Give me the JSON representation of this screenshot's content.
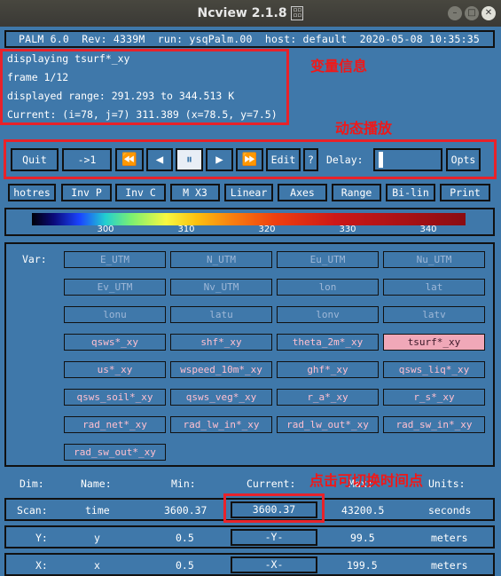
{
  "window": {
    "title": "Ncview 2.1.8",
    "title_icon": "icon-box"
  },
  "info_bar": "PALM 6.0  Rev: 4339M  run: ysqPalm.00  host: default  2020-05-08 10:35:35",
  "variable_info": {
    "displaying": "displaying tsurf*_xy",
    "frame": "frame 1/12",
    "range": "displayed range: 291.293 to 344.513 K",
    "current": "Current: (i=78, j=7) 311.389 (x=78.5, y=7.5)"
  },
  "annotations": {
    "variable_info": "变量信息",
    "playback": "动态播放",
    "switch_time": "点击可切换时间点"
  },
  "controls": {
    "quit": "Quit",
    "step": "->1",
    "rewind": "⏪",
    "back": "◀",
    "pause": "⏸",
    "forward": "▶",
    "fast_forward": "⏩",
    "edit": "Edit",
    "help": "?",
    "delay": "Delay:",
    "opts": "Opts"
  },
  "toolbar": [
    "hotres",
    "Inv P",
    "Inv C",
    "M X3",
    "Linear",
    "Axes",
    "Range",
    "Bi-lin",
    "Print"
  ],
  "colorbar": {
    "ticks": [
      "300",
      "310",
      "320",
      "330",
      "340"
    ]
  },
  "var_label": "Var:",
  "variables": [
    {
      "label": "E_UTM",
      "state": "dim"
    },
    {
      "label": "N_UTM",
      "state": "dim"
    },
    {
      "label": "Eu_UTM",
      "state": "dim"
    },
    {
      "label": "Nu_UTM",
      "state": "dim"
    },
    {
      "label": "Ev_UTM",
      "state": "dim"
    },
    {
      "label": "Nv_UTM",
      "state": "dim"
    },
    {
      "label": "lon",
      "state": "dim"
    },
    {
      "label": "lat",
      "state": "dim"
    },
    {
      "label": "lonu",
      "state": "dim"
    },
    {
      "label": "latu",
      "state": "dim"
    },
    {
      "label": "lonv",
      "state": "dim"
    },
    {
      "label": "latv",
      "state": "dim"
    },
    {
      "label": "qsws*_xy",
      "state": "active"
    },
    {
      "label": "shf*_xy",
      "state": "active"
    },
    {
      "label": "theta_2m*_xy",
      "state": "active"
    },
    {
      "label": "tsurf*_xy",
      "state": "selected"
    },
    {
      "label": "us*_xy",
      "state": "active"
    },
    {
      "label": "wspeed_10m*_xy",
      "state": "active"
    },
    {
      "label": "ghf*_xy",
      "state": "active"
    },
    {
      "label": "qsws_liq*_xy",
      "state": "active"
    },
    {
      "label": "qsws_soil*_xy",
      "state": "active"
    },
    {
      "label": "qsws_veg*_xy",
      "state": "active"
    },
    {
      "label": "r_a*_xy",
      "state": "active"
    },
    {
      "label": "r_s*_xy",
      "state": "active"
    },
    {
      "label": "rad_net*_xy",
      "state": "active"
    },
    {
      "label": "rad_lw_in*_xy",
      "state": "active"
    },
    {
      "label": "rad_lw_out*_xy",
      "state": "active"
    },
    {
      "label": "rad_sw_in*_xy",
      "state": "active"
    },
    {
      "label": "rad_sw_out*_xy",
      "state": "active"
    }
  ],
  "dims_header": {
    "dim": "Dim:",
    "name": "Name:",
    "min": "Min:",
    "current": "Current:",
    "max": "Max:",
    "units": "Units:"
  },
  "dims": [
    {
      "dim": "Scan:",
      "name": "time",
      "min": "3600.37",
      "current": "3600.37",
      "max": "43200.5",
      "units": "seconds"
    },
    {
      "dim": "Y:",
      "name": "y",
      "min": "0.5",
      "current": "-Y-",
      "max": "99.5",
      "units": "meters"
    },
    {
      "dim": "X:",
      "name": "x",
      "min": "0.5",
      "current": "-X-",
      "max": "199.5",
      "units": "meters"
    }
  ],
  "colors": {
    "background": "#3f78aa",
    "annotation": "#f01818",
    "selected": "#f0a8b8"
  }
}
